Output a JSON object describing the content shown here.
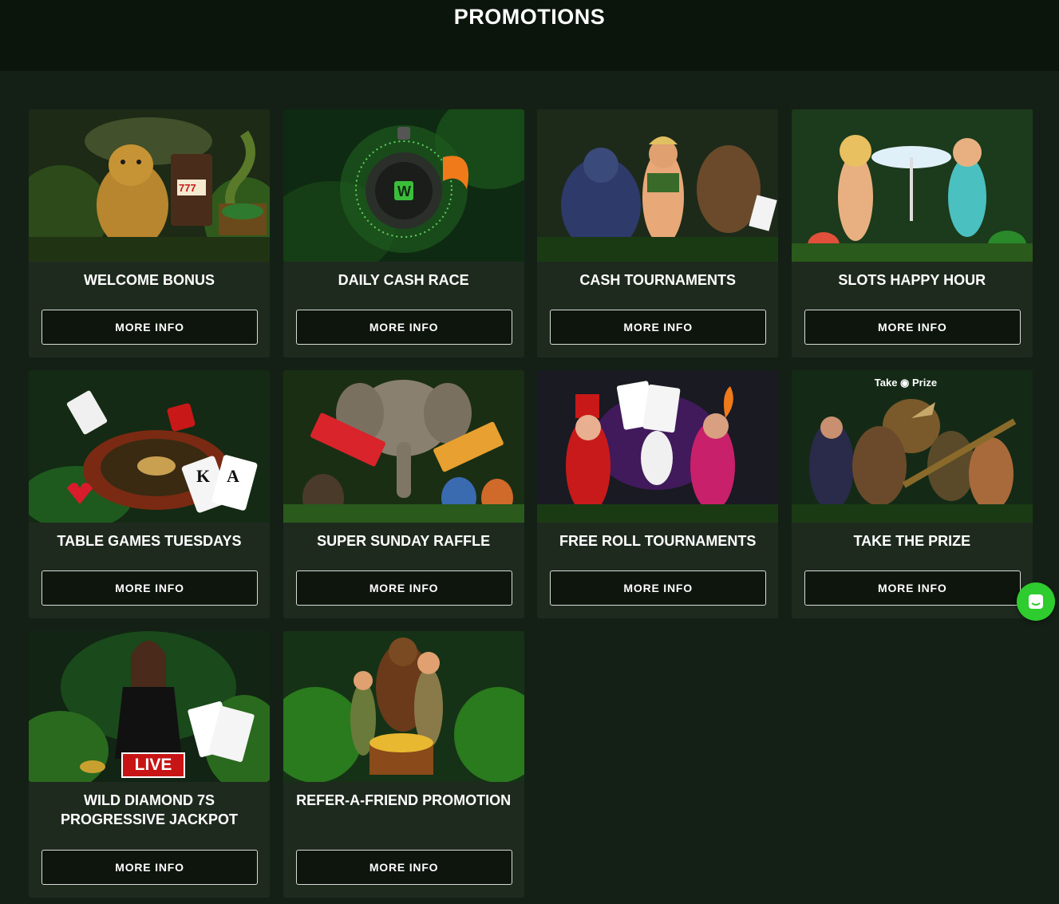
{
  "page": {
    "title": "PROMOTIONS"
  },
  "colors": {
    "background": "#142016",
    "header": "#0b150b",
    "card": "#1f2a1f",
    "button": "#0d150d",
    "chat": "#2ecc2e"
  },
  "promotions": [
    {
      "title": "WELCOME BONUS",
      "button": "MORE INFO",
      "image_icon": "jaguar-slot-machine-image"
    },
    {
      "title": "DAILY CASH RACE",
      "button": "MORE INFO",
      "image_icon": "stopwatch-image"
    },
    {
      "title": "CASH TOURNAMENTS",
      "button": "MORE INFO",
      "image_icon": "jungle-characters-image"
    },
    {
      "title": "SLOTS HAPPY HOUR",
      "button": "MORE INFO",
      "image_icon": "beach-party-image"
    },
    {
      "title": "TABLE GAMES TUESDAYS",
      "button": "MORE INFO",
      "image_icon": "roulette-cards-image"
    },
    {
      "title": "SUPER SUNDAY RAFFLE",
      "button": "MORE INFO",
      "image_icon": "elephant-tickets-image"
    },
    {
      "title": "FREE ROLL TOURNAMENTS",
      "button": "MORE INFO",
      "image_icon": "magician-performers-image"
    },
    {
      "title": "TAKE THE PRIZE",
      "button": "MORE INFO",
      "image_icon": "dinosaur-pirate-image",
      "logo_text": "Take the Prize"
    },
    {
      "title": "WILD DIAMOND 7S PROGRESSIVE JACKPOT",
      "button": "MORE INFO",
      "image_icon": "live-dealer-image",
      "badge": "LIVE"
    },
    {
      "title": "REFER-A-FRIEND PROMOTION",
      "button": "MORE INFO",
      "image_icon": "bear-explorers-treasure-image"
    }
  ],
  "chat": {
    "icon": "chat-icon"
  }
}
